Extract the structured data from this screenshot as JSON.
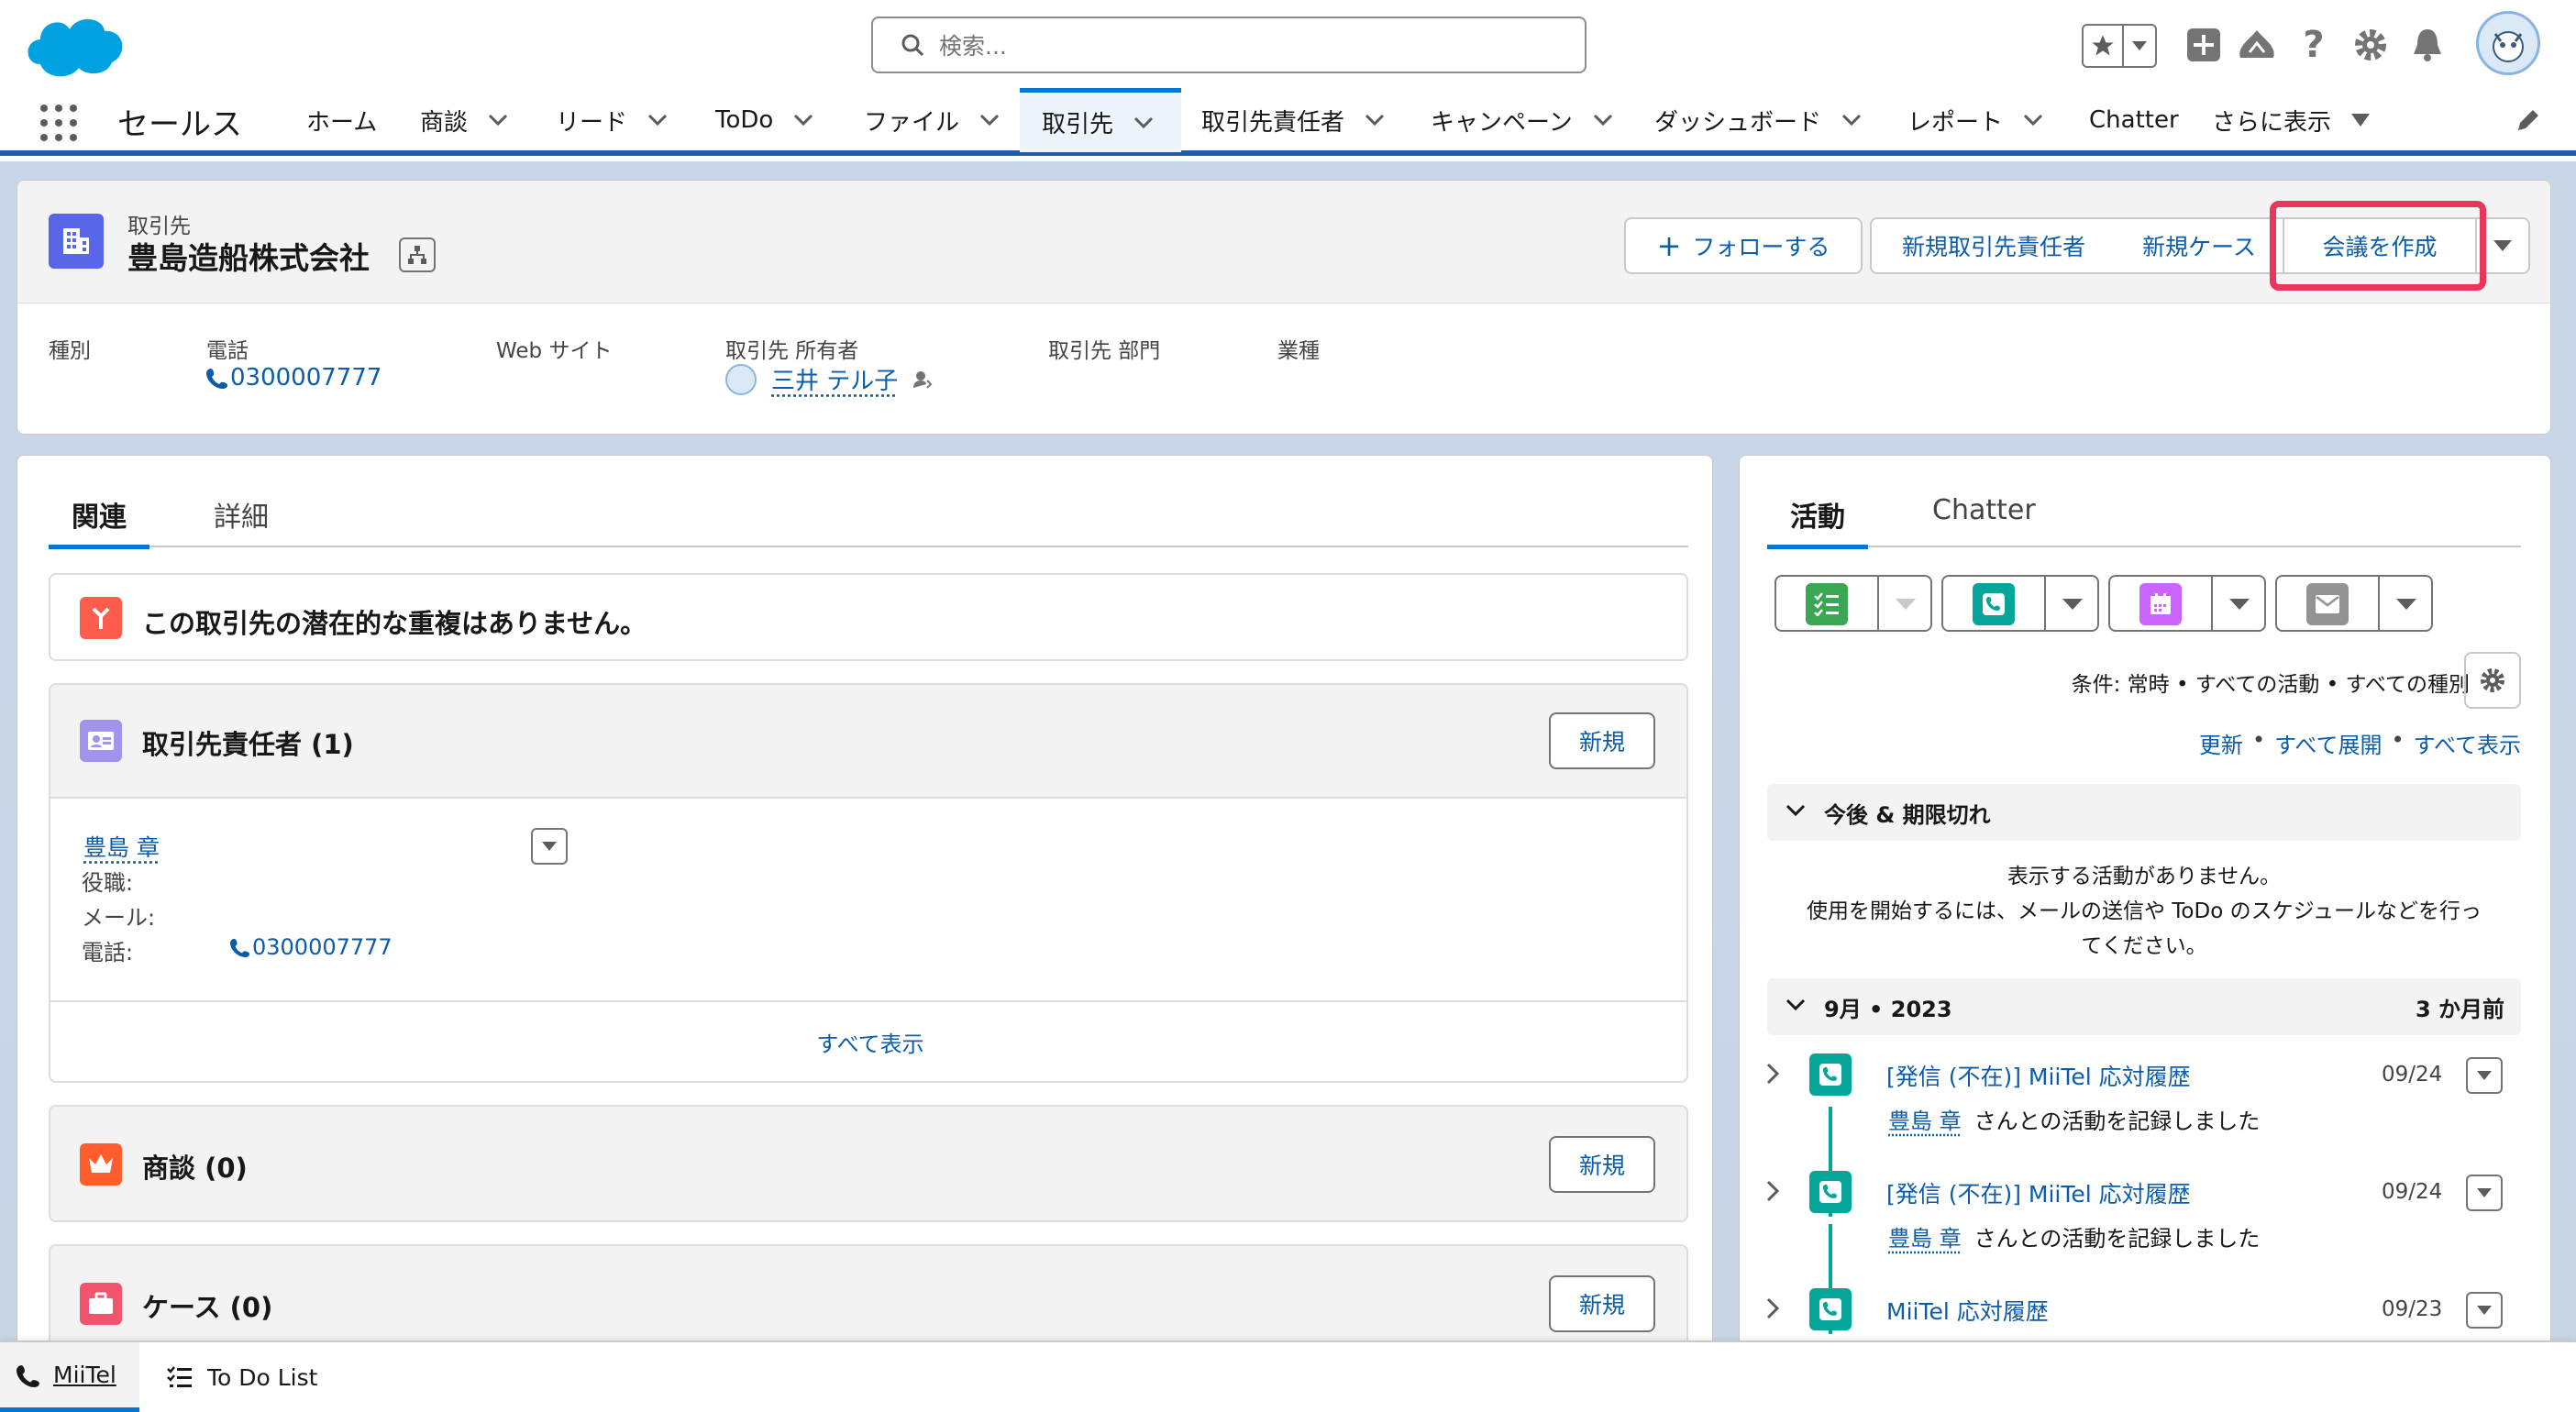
{
  "header": {
    "search_placeholder": "検索...",
    "icons": [
      "favorites-icon",
      "add-icon",
      "trailhead-icon",
      "help-icon",
      "setup-gear-icon",
      "notification-bell-icon",
      "avatar"
    ]
  },
  "nav": {
    "app_name": "セールス",
    "items": [
      {
        "label": "ホーム",
        "chevron": false
      },
      {
        "label": "商談",
        "chevron": true
      },
      {
        "label": "リード",
        "chevron": true
      },
      {
        "label": "ToDo",
        "chevron": true
      },
      {
        "label": "ファイル",
        "chevron": true
      },
      {
        "label": "取引先",
        "chevron": true,
        "active": true
      },
      {
        "label": "取引先責任者",
        "chevron": true
      },
      {
        "label": "キャンペーン",
        "chevron": true
      },
      {
        "label": "ダッシュボード",
        "chevron": true
      },
      {
        "label": "レポート",
        "chevron": true
      },
      {
        "label": "Chatter",
        "chevron": false
      }
    ],
    "more": "さらに表示"
  },
  "record": {
    "object_label": "取引先",
    "name": "豊島造船株式会社",
    "actions": {
      "follow": "フォローする",
      "new_contact": "新規取引先責任者",
      "new_case": "新規ケース",
      "create_meeting": "会議を作成"
    },
    "fields": {
      "type_label": "種別",
      "phone_label": "電話",
      "phone_value": "0300007777",
      "website_label": "Web サイト",
      "owner_label": "取引先 所有者",
      "owner_value": "三井 テル子",
      "division_label": "取引先 部門",
      "industry_label": "業種"
    }
  },
  "left": {
    "tabs": {
      "related": "関連",
      "details": "詳細"
    },
    "duplicate_message": "この取引先の潜在的な重複はありません。",
    "contacts": {
      "title": "取引先責任者 (1)",
      "new_label": "新規",
      "contact_name": "豊島 章",
      "title_label": "役職:",
      "email_label": "メール:",
      "phone_label": "電話:",
      "phone_value": "0300007777",
      "view_all": "すべて表示"
    },
    "opportunities": {
      "title": "商談 (0)",
      "new_label": "新規"
    },
    "cases": {
      "title": "ケース (0)",
      "new_label": "新規"
    }
  },
  "right": {
    "tabs": {
      "activity": "活動",
      "chatter": "Chatter"
    },
    "filter_text": "条件: 常時 • すべての活動 • すべての種別",
    "links": {
      "refresh": "更新",
      "expand_all": "すべて展開",
      "view_all": "すべて表示",
      "sep": "•"
    },
    "upcoming": {
      "title": "今後 & 期限切れ",
      "empty_line1": "表示する活動がありません。",
      "empty_line2": "使用を開始するには、メールの送信や ToDo のスケジュールなどを行っ",
      "empty_line3": "てください。"
    },
    "month": {
      "title": "9月 • 2023",
      "ago": "3 か月前"
    },
    "items": [
      {
        "subject": "[発信 (不在)] MiiTel 応対履歴",
        "date": "09/24",
        "who": "豊島 章",
        "desc": "さんとの活動を記録しました"
      },
      {
        "subject": "[発信 (不在)] MiiTel 応対履歴",
        "date": "09/24",
        "who": "豊島 章",
        "desc": "さんとの活動を記録しました"
      },
      {
        "subject": "MiiTel 応対履歴",
        "date": "09/23"
      }
    ]
  },
  "utility": {
    "miitel": "MiiTel",
    "todo": "To Do List"
  },
  "colors": {
    "brand": "#0176d3",
    "link": "#0b5cab",
    "highlight": "#e8375a",
    "account_icon": "#5867e8",
    "teal": "#06a59a"
  }
}
